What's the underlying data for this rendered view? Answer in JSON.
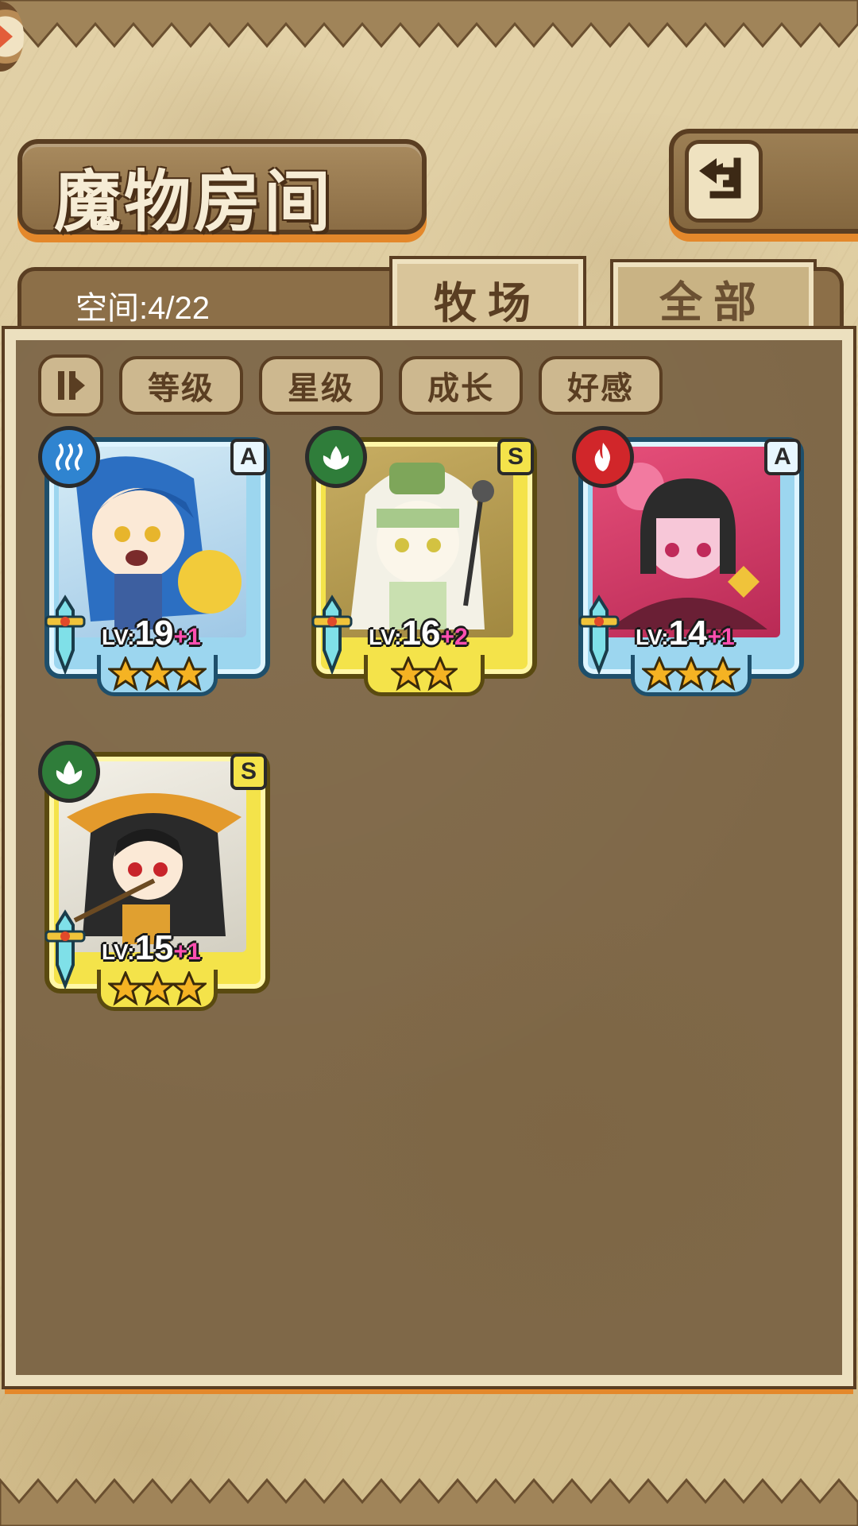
{
  "header": {
    "title": "魔物房间",
    "back_icon": "return-arrow-icon"
  },
  "info": {
    "space_label": "空间:4/22"
  },
  "tabs": [
    {
      "label": "牧场",
      "active": true
    },
    {
      "label": "全部",
      "active": false
    }
  ],
  "filters": {
    "sort_icon": "sort-toggle-icon",
    "buttons": [
      "等级",
      "星级",
      "成长",
      "好感"
    ]
  },
  "monsters": [
    {
      "element": "water",
      "rank": "A",
      "level_prefix": "LV:",
      "level": "19",
      "bonus": "+1",
      "stars": 3,
      "frame": "blue"
    },
    {
      "element": "wood",
      "rank": "S",
      "level_prefix": "LV:",
      "level": "16",
      "bonus": "+2",
      "stars": 2,
      "frame": "yellow"
    },
    {
      "element": "fire",
      "rank": "A",
      "level_prefix": "LV:",
      "level": "14",
      "bonus": "+1",
      "stars": 3,
      "frame": "blue"
    },
    {
      "element": "wood",
      "rank": "S",
      "level_prefix": "LV:",
      "level": "15",
      "bonus": "+1",
      "stars": 3,
      "frame": "yellow"
    }
  ],
  "colors": {
    "panel": "#7f6848",
    "panel_border": "#ece0bf",
    "outline": "#5a3e22",
    "accent_orange": "#e4882b",
    "bonus_pink": "#ff4fb0",
    "water": "#2f84d0",
    "wood": "#2f7d3a",
    "fire": "#d1262a"
  }
}
